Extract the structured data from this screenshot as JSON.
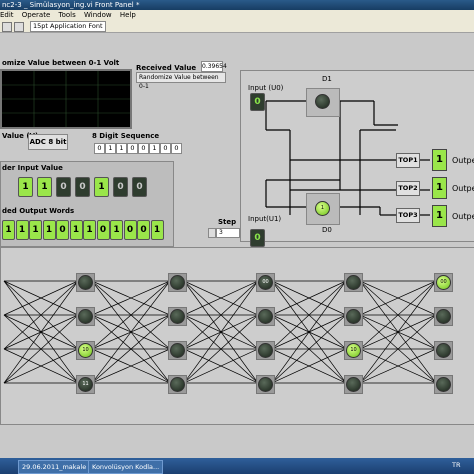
{
  "window": {
    "title": "nc2-3 _ Simülasyon_ing.vi Front Panel *"
  },
  "menu": [
    "Edit",
    "Operate",
    "Tools",
    "Window",
    "Help"
  ],
  "toolbar": {
    "font_label": "15pt Application Font"
  },
  "left": {
    "graph_title": "omize Value between 0-1 Volt",
    "value_label": "Value (V)",
    "adc_label": "ADC 8 bit",
    "sequence_label": "8 Digit Sequence",
    "sequence": [
      "0",
      "1",
      "1",
      "0",
      "0",
      "1",
      "0",
      "0"
    ],
    "encoder_label": "der Input Value",
    "encoder_leds": [
      "1",
      "1",
      "0",
      "0",
      "1",
      "0",
      "0"
    ],
    "encoder_states": [
      true,
      true,
      false,
      false,
      true,
      false,
      false
    ],
    "encoded_label": "ded Output Words",
    "encoded_leds": [
      "1",
      "1",
      "1",
      "1",
      "0",
      "1",
      "1",
      "0",
      "1",
      "0",
      "0",
      "1"
    ]
  },
  "received": {
    "label": "Received Value",
    "value": "0.39654",
    "dropdown": "Randomize Value between 0-1"
  },
  "step": {
    "label": "Step",
    "value": "3"
  },
  "circuit": {
    "input0_label": "Input (U0)",
    "input1_label": "Input(U1)",
    "d1_label": "D1",
    "d0_label": "D0",
    "input0_value": "0",
    "input1_value": "0",
    "d0_value": "1",
    "top_labels": [
      "TOP1",
      "TOP2",
      "TOP3"
    ],
    "output_values": [
      "1",
      "1",
      "1"
    ],
    "output_label": "Outpe"
  },
  "trellis": {
    "column_nodes": [
      [
        {
          "t": "",
          "on": false
        },
        {
          "t": "",
          "on": false
        },
        {
          "t": "10",
          "on": true
        },
        {
          "t": "11",
          "on": false
        }
      ],
      [
        {
          "t": "",
          "on": false
        },
        {
          "t": "",
          "on": false
        },
        {
          "t": "",
          "on": false
        },
        {
          "t": "",
          "on": false
        }
      ],
      [
        {
          "t": "00",
          "on": false
        },
        {
          "t": "",
          "on": false
        },
        {
          "t": "",
          "on": false
        },
        {
          "t": "",
          "on": false
        }
      ],
      [
        {
          "t": "",
          "on": false
        },
        {
          "t": "",
          "on": false
        },
        {
          "t": "10",
          "on": true
        },
        {
          "t": "",
          "on": false
        }
      ],
      [
        {
          "t": "00",
          "on": true
        },
        {
          "t": "",
          "on": false
        },
        {
          "t": "",
          "on": false
        },
        {
          "t": "",
          "on": false
        }
      ]
    ]
  },
  "taskbar": {
    "items": [
      "29.06.2011_makale",
      "Konvolüsyon Kodla..."
    ],
    "clock": "TR"
  }
}
